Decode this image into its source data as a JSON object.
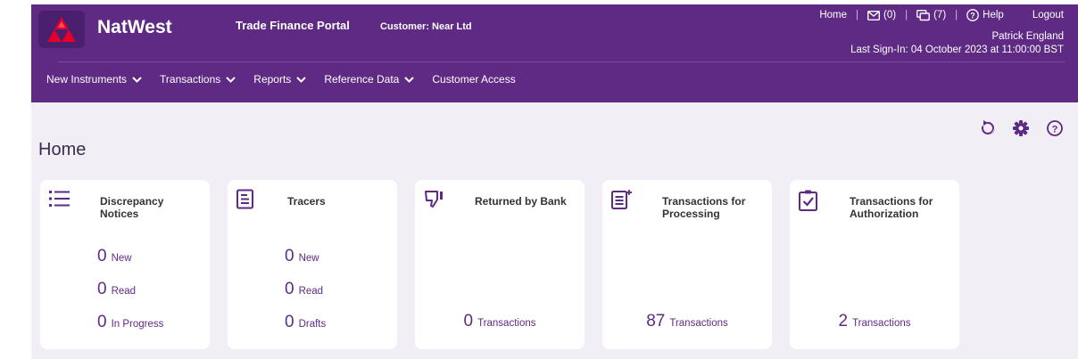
{
  "header": {
    "brand": "NatWest",
    "portal_title": "Trade Finance Portal",
    "customer_label": "Customer:",
    "customer_name": "Near Ltd",
    "links": {
      "home": "Home",
      "mail": "(0)",
      "messages": "(7)",
      "help": "Help",
      "logout": "Logout"
    },
    "user_name": "Patrick England",
    "last_sign_in": "Last Sign-In: 04 October 2023 at 11:00:00 BST",
    "brand_color": "#5e2a84"
  },
  "nav": [
    {
      "label": "New Instruments",
      "dropdown": true
    },
    {
      "label": "Transactions",
      "dropdown": true
    },
    {
      "label": "Reports",
      "dropdown": true
    },
    {
      "label": "Reference Data",
      "dropdown": true
    },
    {
      "label": "Customer Access",
      "dropdown": false
    }
  ],
  "page": {
    "title": "Home"
  },
  "toolbar_icons": [
    "refresh-icon",
    "settings-gear-icon",
    "help-icon"
  ],
  "cards": [
    {
      "icon": "list-icon",
      "title": "Discrepancy Notices",
      "rows": [
        {
          "value": "0",
          "label": "New"
        },
        {
          "value": "0",
          "label": "Read"
        },
        {
          "value": "0",
          "label": "In Progress"
        }
      ]
    },
    {
      "icon": "document-icon",
      "title": "Tracers",
      "rows": [
        {
          "value": "0",
          "label": "New"
        },
        {
          "value": "0",
          "label": "Read"
        },
        {
          "value": "0",
          "label": "Drafts"
        }
      ]
    },
    {
      "icon": "thumbs-down-icon",
      "title": "Returned by Bank",
      "total": {
        "value": "0",
        "label": "Transactions"
      }
    },
    {
      "icon": "document-plus-icon",
      "title": "Transactions for Processing",
      "total": {
        "value": "87",
        "label": "Transactions"
      }
    },
    {
      "icon": "checklist-icon",
      "title": "Transactions for Authorization",
      "total": {
        "value": "2",
        "label": "Transactions"
      }
    }
  ]
}
